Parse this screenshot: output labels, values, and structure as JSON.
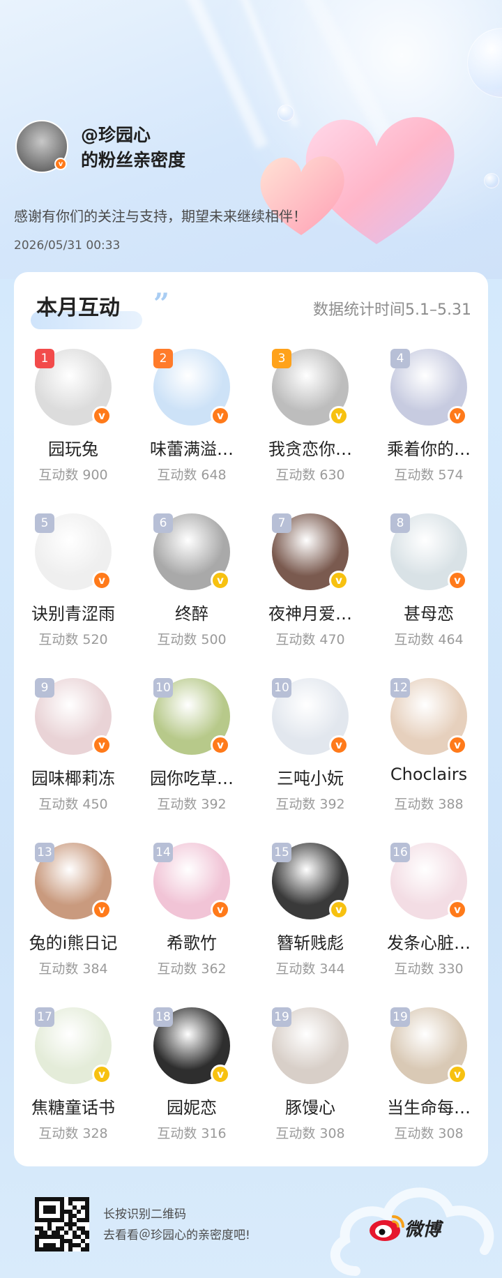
{
  "header": {
    "handle": "@珍园心",
    "subtitle": "的粉丝亲密度",
    "message": "感谢有你们的关注与支持，期望未来继续相伴！",
    "date": "2026/05/31 00:33",
    "verified_mark": "v"
  },
  "card": {
    "title": "本月互动",
    "quote": "”",
    "range": "数据统计时间5.1–5.31"
  },
  "fans": [
    {
      "rank": "1",
      "name": "园玩兔",
      "count": "互动数 900",
      "badge": "orange",
      "avatar": "#dcdcdc"
    },
    {
      "rank": "2",
      "name": "味蕾满溢…",
      "count": "互动数 648",
      "badge": "orange",
      "avatar": "#cde2f7"
    },
    {
      "rank": "3",
      "name": "我贪恋你…",
      "count": "互动数 630",
      "badge": "gold",
      "avatar": "#bdbdbd"
    },
    {
      "rank": "4",
      "name": "乘着你的…",
      "count": "互动数 574",
      "badge": "orange",
      "avatar": "#c7cbe0"
    },
    {
      "rank": "5",
      "name": "诀别青涩雨",
      "count": "互动数 520",
      "badge": "orange",
      "avatar": "#efefef"
    },
    {
      "rank": "6",
      "name": "终醉",
      "count": "互动数 500",
      "badge": "gold",
      "avatar": "#a9a9a9"
    },
    {
      "rank": "7",
      "name": "夜神月爱…",
      "count": "互动数 470",
      "badge": "gold",
      "avatar": "#7a5a4f"
    },
    {
      "rank": "8",
      "name": "甚母恋",
      "count": "互动数 464",
      "badge": "orange",
      "avatar": "#d9e2e6"
    },
    {
      "rank": "9",
      "name": "园味椰莉冻",
      "count": "互动数 450",
      "badge": "orange",
      "avatar": "#e9d3d6"
    },
    {
      "rank": "10",
      "name": "园你吃草…",
      "count": "互动数 392",
      "badge": "orange",
      "avatar": "#b7c98a"
    },
    {
      "rank": "10",
      "name": "三吨小妧",
      "count": "互动数 392",
      "badge": "orange",
      "avatar": "#e2e7ee"
    },
    {
      "rank": "12",
      "name": "Choclairs",
      "count": "互动数 388",
      "badge": "orange",
      "avatar": "#e6d0bd"
    },
    {
      "rank": "13",
      "name": "兔的i熊日记",
      "count": "互动数 384",
      "badge": "orange",
      "avatar": "#c99a7e"
    },
    {
      "rank": "14",
      "name": "希歌竹",
      "count": "互动数 362",
      "badge": "orange",
      "avatar": "#f1c4d6"
    },
    {
      "rank": "15",
      "name": "簪斩贱彪",
      "count": "互动数 344",
      "badge": "gold",
      "avatar": "#3a3a3a"
    },
    {
      "rank": "16",
      "name": "发条心脏…",
      "count": "互动数 330",
      "badge": "orange",
      "avatar": "#f3dde4"
    },
    {
      "rank": "17",
      "name": "焦糖童话书",
      "count": "互动数 328",
      "badge": "gold",
      "avatar": "#e4ecd9"
    },
    {
      "rank": "18",
      "name": "园妮恋",
      "count": "互动数 316",
      "badge": "gold",
      "avatar": "#2e2e2e"
    },
    {
      "rank": "19",
      "name": "豚馒心",
      "count": "互动数 308",
      "badge": "",
      "avatar": "#d8cfc8"
    },
    {
      "rank": "19",
      "name": "当生命每…",
      "count": "互动数 308",
      "badge": "gold",
      "avatar": "#d9c9b5"
    }
  ],
  "footer": {
    "line1": "长按识别二维码",
    "line2": "去看看＠珍园心的亲密度吧!",
    "brand": "微博"
  },
  "colors": {
    "badge_orange": "#ff7a1a",
    "badge_gold": "#f7c110",
    "rank1": "#f24b4b",
    "rank2": "#ff7b2a",
    "rank3": "#ffa21a",
    "rank_default": "#b7bfd6",
    "weibo_red": "#e6162d"
  }
}
